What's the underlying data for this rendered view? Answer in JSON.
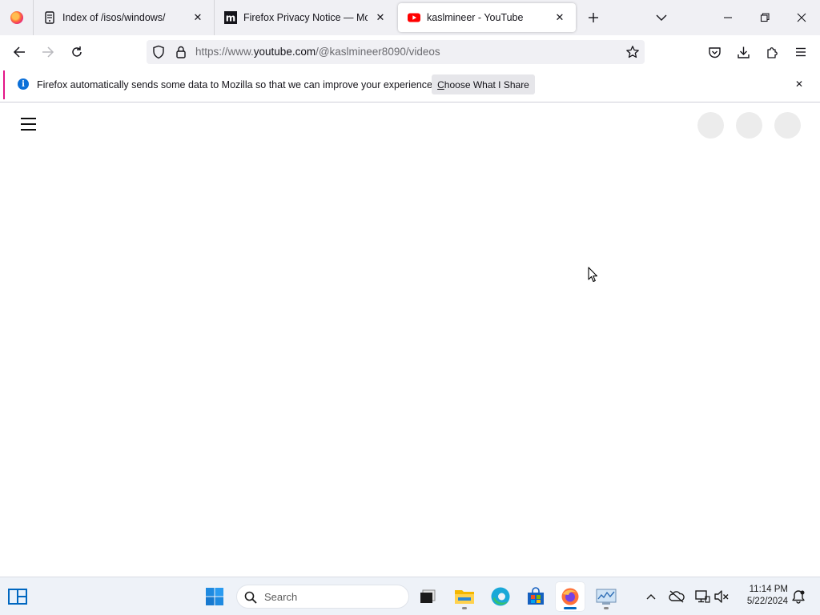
{
  "browser": {
    "tabs": [
      {
        "title": "Index of /isos/windows/",
        "favicon": "server-icon",
        "active": false
      },
      {
        "title": "Firefox Privacy Notice — Mozill",
        "favicon": "mozilla-m-icon",
        "active": false
      },
      {
        "title": "kaslmineer - YouTube",
        "favicon": "youtube-icon",
        "active": true
      }
    ],
    "url": {
      "prefix": "https://www.",
      "host": "youtube.com",
      "path": "/@kaslmineer8090/videos"
    }
  },
  "notification": {
    "message": "Firefox automatically sends some data to Mozilla so that we can improve your experience.",
    "button_label": "Choose What I Share",
    "button_accel": "C",
    "button_rest": "hoose What I Share"
  },
  "taskbar": {
    "search_placeholder": "Search",
    "time": "11:14 PM",
    "date": "5/22/2024"
  },
  "colors": {
    "accent": "#0b6fd8",
    "notification_stripe": "#e31587",
    "youtube_red": "#ff0000",
    "tab_strip_bg": "#f0f0f4"
  }
}
